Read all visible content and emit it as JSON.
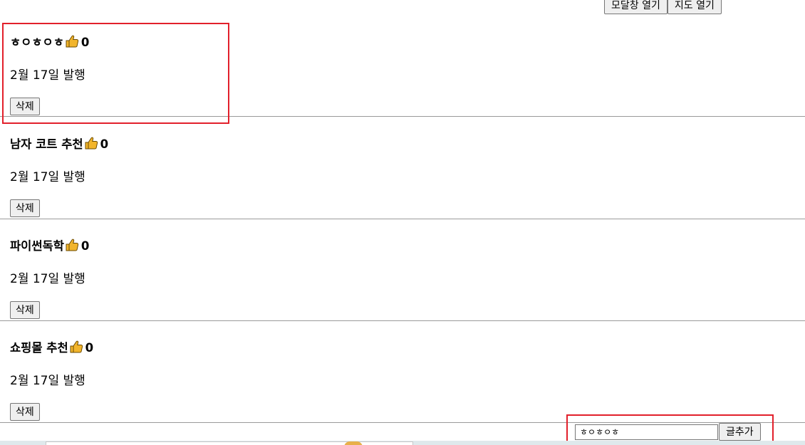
{
  "toolbar": {
    "modal_button": "모달창 열기",
    "map_button": "지도 열기"
  },
  "posts": [
    {
      "title": "ㅎㅇㅎㅇㅎ",
      "likes": "0",
      "date": "2월 17일 발행",
      "delete_label": "삭제"
    },
    {
      "title": "남자 코트 추천",
      "likes": "0",
      "date": "2월 17일 발행",
      "delete_label": "삭제"
    },
    {
      "title": "파이썬독학",
      "likes": "0",
      "date": "2월 17일 발행",
      "delete_label": "삭제"
    },
    {
      "title": "쇼핑몰 추천",
      "likes": "0",
      "date": "2월 17일 발행",
      "delete_label": "삭제"
    }
  ],
  "add_post": {
    "input_value": "ㅎㅇㅎㅇㅎ",
    "button_label": "글추가"
  },
  "icons": {
    "like": "thumbs-up-icon"
  },
  "colors": {
    "highlight": "#e2202b",
    "thumb": "#f2b52c"
  }
}
